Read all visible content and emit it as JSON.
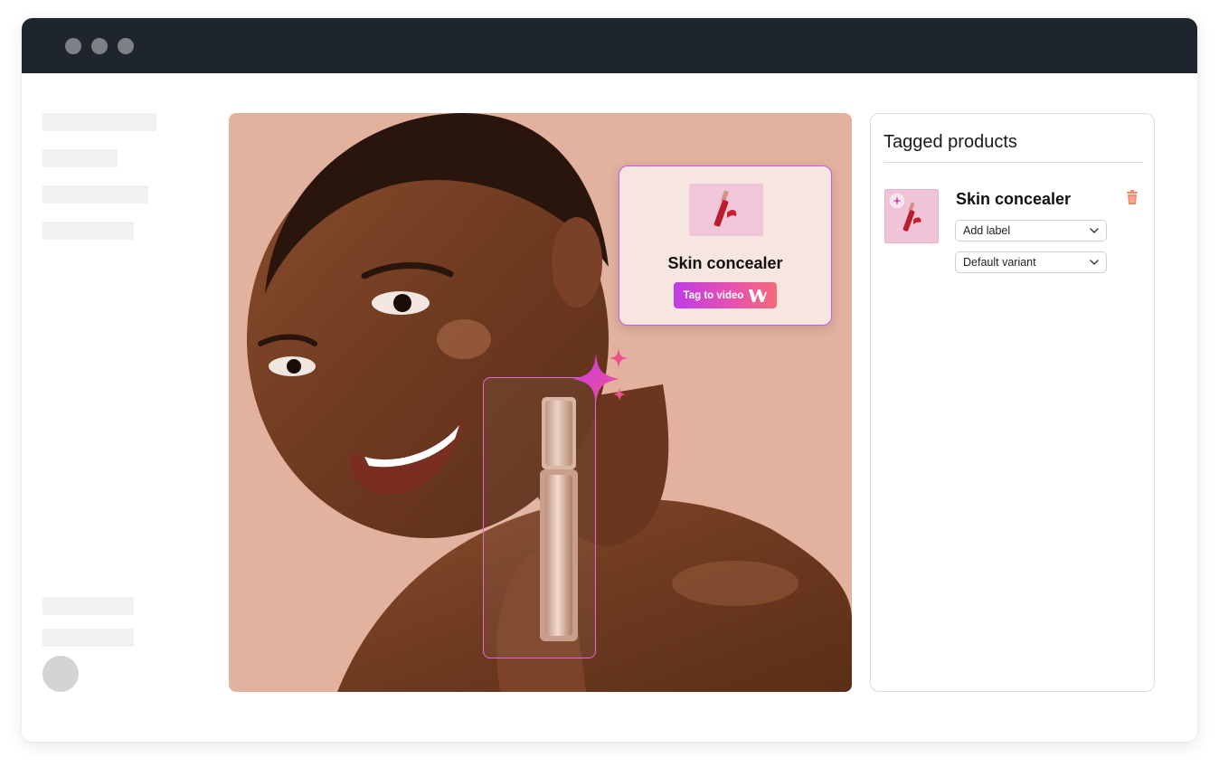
{
  "popup": {
    "product_name": "Skin concealer",
    "button_label": "Tag to video"
  },
  "panel": {
    "title": "Tagged products",
    "product": {
      "name": "Skin concealer",
      "label_select": "Add label",
      "variant_select": "Default variant"
    }
  },
  "colors": {
    "titlebar": "#1e252c",
    "accent_gradient_start": "#c03ce8",
    "accent_gradient_end": "#f56b79",
    "trash_icon": "#f08a6a",
    "stage_background": "#e3b29f"
  }
}
